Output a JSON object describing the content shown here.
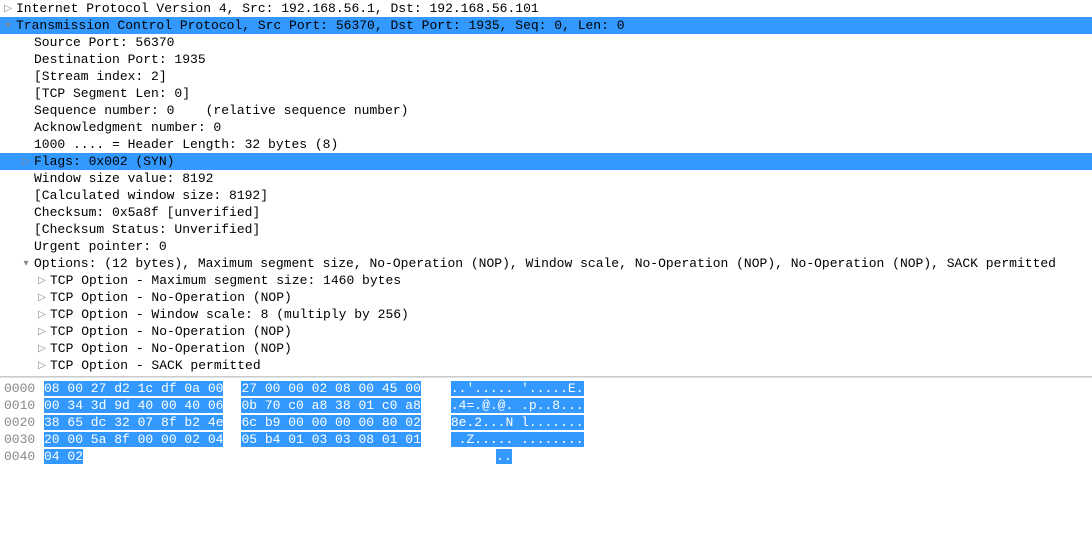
{
  "details": {
    "ip_line": "Internet Protocol Version 4, Src: 192.168.56.1, Dst: 192.168.56.101",
    "tcp_line": "Transmission Control Protocol, Src Port: 56370, Dst Port: 1935, Seq: 0, Len: 0",
    "src_port": "Source Port: 56370",
    "dst_port": "Destination Port: 1935",
    "stream_idx": "[Stream index: 2]",
    "seg_len": "[TCP Segment Len: 0]",
    "seq_num": "Sequence number: 0    (relative sequence number)",
    "ack_num": "Acknowledgment number: 0",
    "hdr_len": "1000 .... = Header Length: 32 bytes (8)",
    "flags": "Flags: 0x002 (SYN)",
    "win_size": "Window size value: 8192",
    "calc_win": "[Calculated window size: 8192]",
    "checksum": "Checksum: 0x5a8f [unverified]",
    "chk_status": "[Checksum Status: Unverified]",
    "urg_ptr": "Urgent pointer: 0",
    "options": "Options: (12 bytes), Maximum segment size, No-Operation (NOP), Window scale, No-Operation (NOP), No-Operation (NOP), SACK permitted",
    "opt_mss": "TCP Option - Maximum segment size: 1460 bytes",
    "opt_nop1": "TCP Option - No-Operation (NOP)",
    "opt_ws": "TCP Option - Window scale: 8 (multiply by 256)",
    "opt_nop2": "TCP Option - No-Operation (NOP)",
    "opt_nop3": "TCP Option - No-Operation (NOP)",
    "opt_sack": "TCP Option - SACK permitted"
  },
  "hex": {
    "offsets": [
      "0000",
      "0010",
      "0020",
      "0030",
      "0040"
    ],
    "bytes_a": [
      "08 00 27 d2 1c df 0a 00",
      "00 34 3d 9d 40 00 40 06",
      "38 65 dc 32 07 8f b2 4e",
      "20 00 5a 8f 00 00 02 04",
      "04 02"
    ],
    "bytes_b": [
      "27 00 00 02 08 00 45 00",
      "0b 70 c0 a8 38 01 c0 a8",
      "6c b9 00 00 00 00 80 02",
      "05 b4 01 03 03 08 01 01",
      ""
    ],
    "ascii": [
      "..'..... '.....E.",
      ".4=.@.@. .p..8...",
      "8e.2...N l.......",
      " .Z..... ........",
      ".."
    ]
  }
}
